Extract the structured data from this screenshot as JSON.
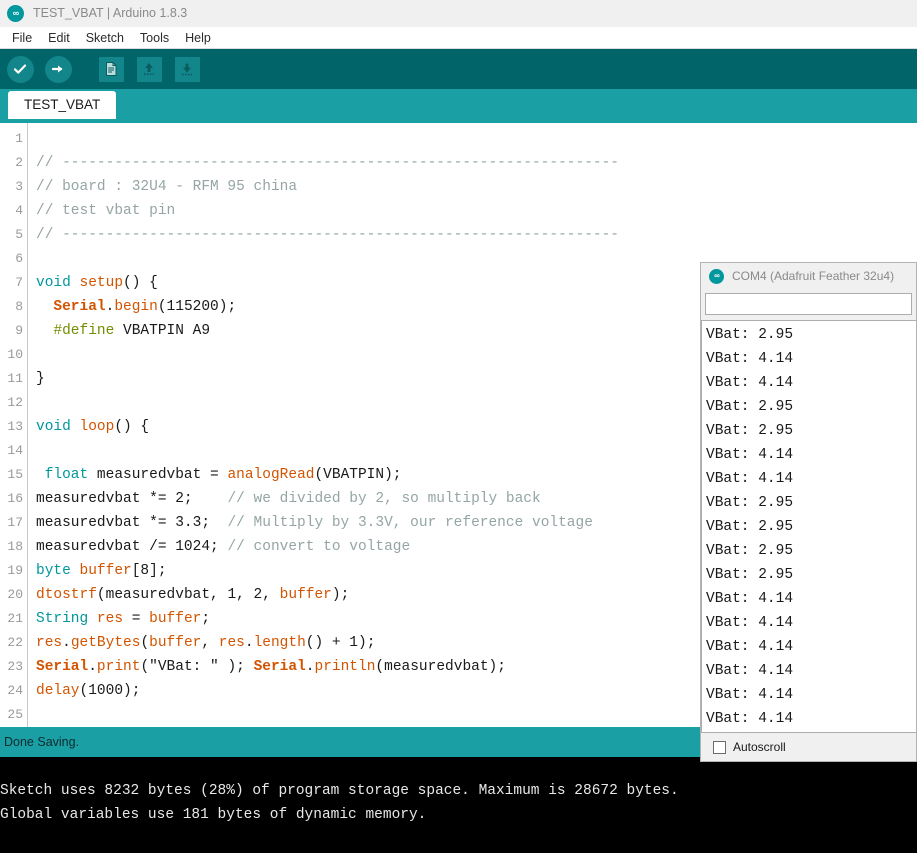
{
  "window": {
    "title": "TEST_VBAT | Arduino 1.8.3",
    "logo_icon": "arduino-infinity-icon",
    "logo_glyph": "∞"
  },
  "menubar": {
    "items": [
      {
        "label": "File"
      },
      {
        "label": "Edit"
      },
      {
        "label": "Sketch"
      },
      {
        "label": "Tools"
      },
      {
        "label": "Help"
      }
    ]
  },
  "toolbar": {
    "buttons": [
      {
        "name": "verify-button",
        "icon": "checkmark-icon",
        "glyph": "✔"
      },
      {
        "name": "upload-button",
        "icon": "right-arrow-icon",
        "glyph": "→"
      },
      {
        "name": "new-button",
        "icon": "new-document-icon",
        "glyph": "▤"
      },
      {
        "name": "open-button",
        "icon": "up-arrow-icon",
        "glyph": "↑"
      },
      {
        "name": "save-button",
        "icon": "down-arrow-icon",
        "glyph": "↓"
      }
    ]
  },
  "tabs": {
    "active": "TEST_VBAT",
    "items": [
      {
        "label": "TEST_VBAT"
      }
    ]
  },
  "editor": {
    "line_numbers": [
      "1",
      "2",
      "3",
      "4",
      "5",
      "6",
      "7",
      "8",
      "9",
      "10",
      "11",
      "12",
      "13",
      "14",
      "15",
      "16",
      "17",
      "18",
      "19",
      "20",
      "21",
      "22",
      "23",
      "24",
      "25"
    ],
    "lines": [
      "",
      "// ----------------------------------------------------------------",
      "// board : 32U4 - RFM 95 china",
      "// test vbat pin",
      "// ----------------------------------------------------------------",
      "",
      "void setup() {",
      "  Serial.begin(115200);",
      "  #define VBATPIN A9",
      "",
      "}",
      "",
      "void loop() {",
      "",
      " float measuredvbat = analogRead(VBATPIN);",
      "measuredvbat *= 2;    // we divided by 2, so multiply back",
      "measuredvbat *= 3.3;  // Multiply by 3.3V, our reference voltage",
      "measuredvbat /= 1024; // convert to voltage",
      "byte buffer[8];",
      "dtostrf(measuredvbat, 1, 2, buffer);",
      "String res = buffer;",
      "res.getBytes(buffer, res.length() + 1);",
      "Serial.print(\"VBat: \" ); Serial.println(measuredvbat);",
      "delay(1000);",
      ""
    ]
  },
  "status": {
    "message": "Done Saving."
  },
  "console": {
    "lines": [
      "Sketch uses 8232 bytes (28%) of program storage space. Maximum is 28672 bytes.",
      "Global variables use 181 bytes of dynamic memory."
    ]
  },
  "serial_monitor": {
    "title": "COM4 (Adafruit Feather 32u4)",
    "logo_icon": "arduino-infinity-icon",
    "logo_glyph": "∞",
    "send_input_value": "",
    "send_input_placeholder": "",
    "output_lines": [
      "VBat: 2.95",
      "VBat: 4.14",
      "VBat: 4.14",
      "VBat: 2.95",
      "VBat: 2.95",
      "VBat: 4.14",
      "VBat: 4.14",
      "VBat: 2.95",
      "VBat: 2.95",
      "VBat: 2.95",
      "VBat: 2.95",
      "VBat: 4.14",
      "VBat: 4.14",
      "VBat: 4.14",
      "VBat: 4.14",
      "VBat: 4.14",
      "VBat: 4.14"
    ],
    "autoscroll_label": "Autoscroll",
    "autoscroll_checked": false
  },
  "colors": {
    "toolbar_bg": "#006468",
    "tabbar_bg": "#1a9fa5",
    "button_bg": "#13868b",
    "status_bg": "#1a9fa5",
    "console_bg": "#000000",
    "accent": "#00979d",
    "comment": "#95a5a6",
    "keyword": "#00979c",
    "function": "#d35400",
    "preproc": "#728e00"
  }
}
